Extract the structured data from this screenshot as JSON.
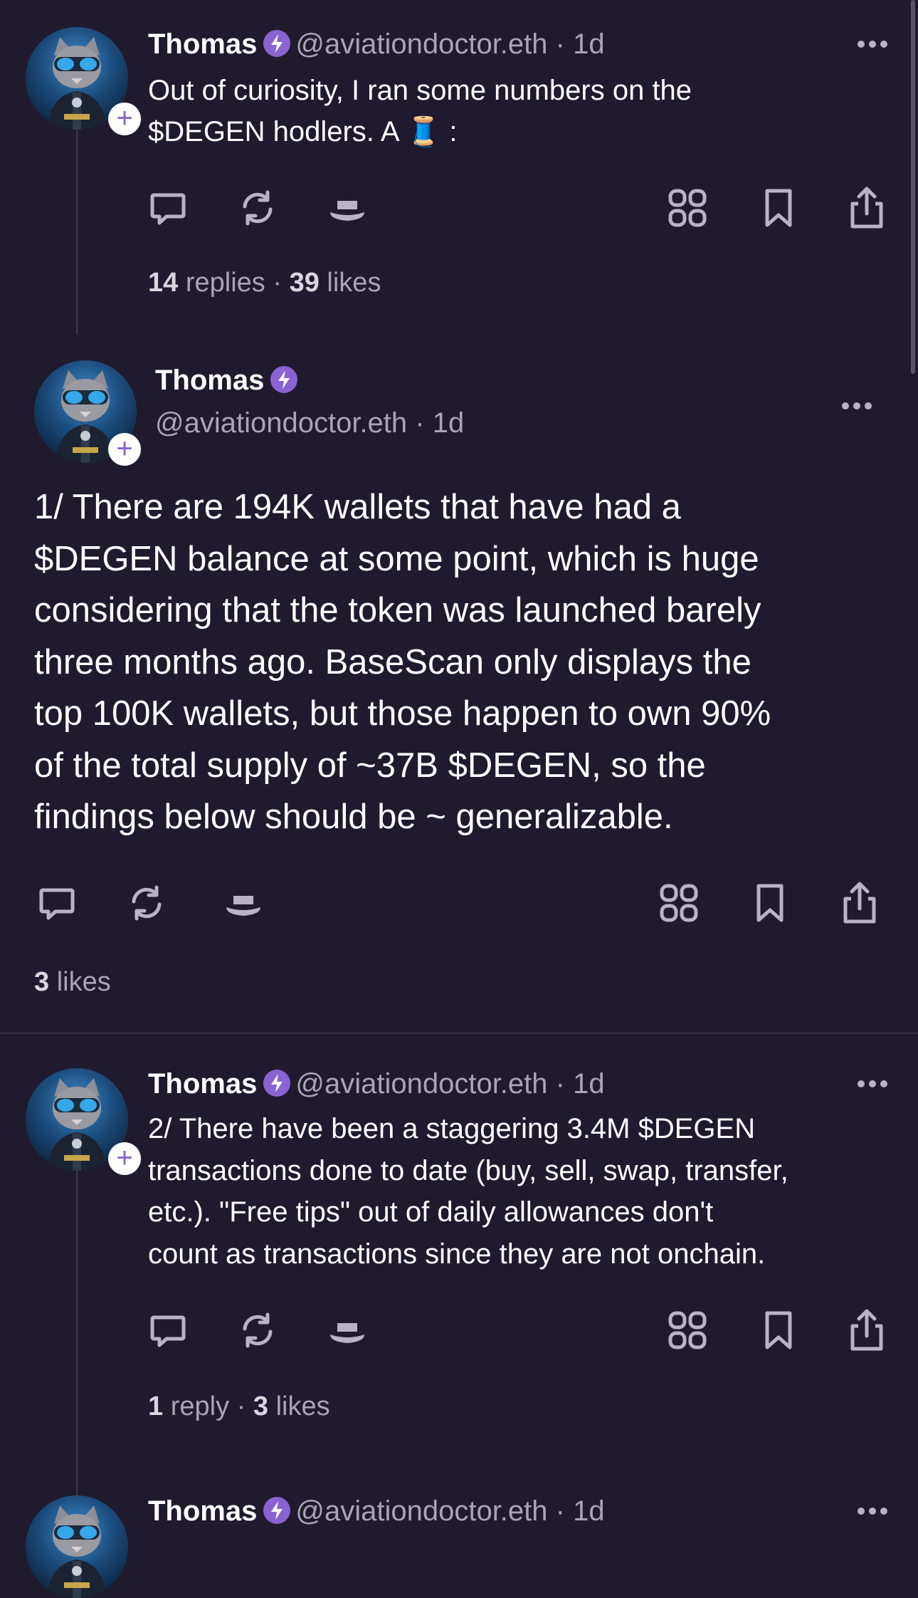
{
  "theme": {
    "background": "#1f1a2d",
    "accent": "#8a63d2",
    "muted_text": "#a9a5b4"
  },
  "posts": [
    {
      "author": "Thomas",
      "handle": "@aviationdoctor.eth",
      "time": "· 1d",
      "text_line1": "Out of curiosity, I ran some numbers on the",
      "text_line2": "$DEGEN hodlers. A",
      "text_line2_end": ":",
      "emoji": "🧵",
      "replies_count": "14",
      "replies_label": "replies",
      "likes_count": "39",
      "likes_label": "likes",
      "separator": "·"
    },
    {
      "author": "Thomas",
      "handle": "@aviationdoctor.eth",
      "time": "· 1d",
      "text_lines": [
        "1/ There are 194K wallets that have had a",
        "$DEGEN balance at some point, which is huge",
        "considering that the token was launched barely",
        "three months ago. BaseScan only displays the",
        "top 100K wallets, but those happen to own 90%",
        "of the total supply of ~37B $DEGEN, so the",
        "findings below should be ~ generalizable."
      ],
      "likes_count": "3",
      "likes_label": "likes"
    },
    {
      "author": "Thomas",
      "handle": "@aviationdoctor.eth",
      "time": "· 1d",
      "text_lines": [
        "2/ There have been a staggering 3.4M $DEGEN",
        "transactions done to date (buy, sell, swap, transfer,",
        "etc.). \"Free tips\" out of daily allowances don't",
        "count as transactions since they are not onchain."
      ],
      "replies_count": "1",
      "replies_label": "reply",
      "likes_count": "3",
      "likes_label": "likes",
      "separator": "·"
    },
    {
      "author": "Thomas",
      "handle": "@aviationdoctor.eth",
      "time": "· 1d"
    }
  ],
  "icons": {
    "comment": "comment-icon",
    "recast": "recast-icon",
    "tip": "tip-hat-icon",
    "apps": "apps-grid-icon",
    "bookmark": "bookmark-icon",
    "share": "share-icon",
    "more": "more-dots-icon",
    "verified": "verified-badge-icon",
    "follow": "follow-plus-icon"
  }
}
